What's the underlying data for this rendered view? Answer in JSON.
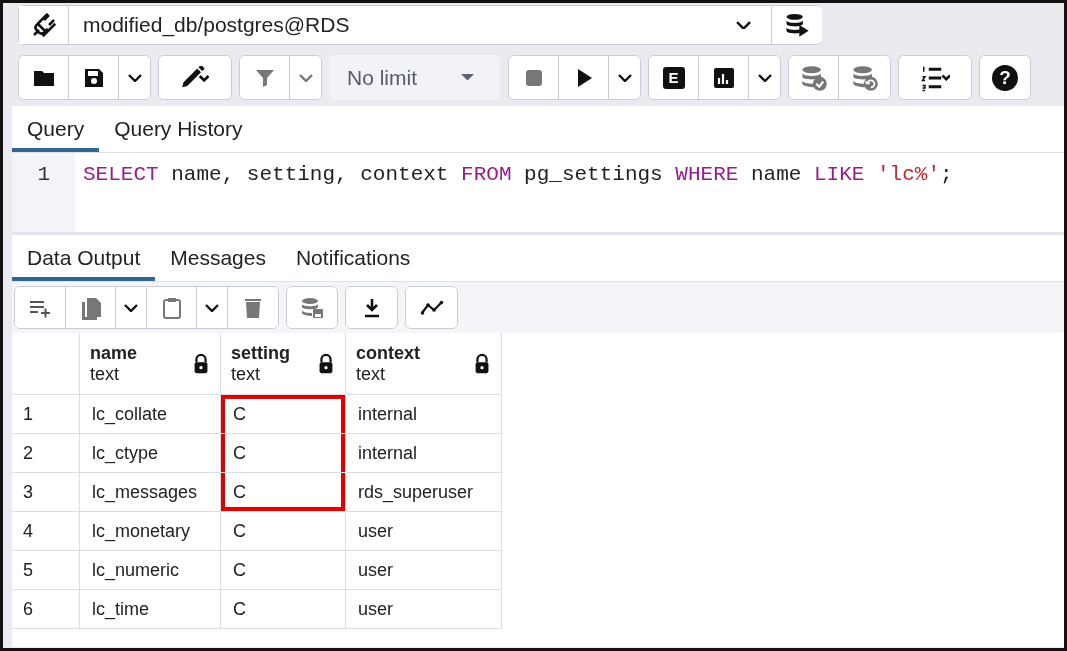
{
  "connection": {
    "title": "modified_db/postgres@RDS"
  },
  "toolbar": {
    "row_limit": "No limit",
    "explain_label": "E",
    "help_label": "?"
  },
  "query_tabs": [
    {
      "label": "Query",
      "selected": true
    },
    {
      "label": "Query History",
      "selected": false
    }
  ],
  "editor": {
    "lines": [
      {
        "number": "1",
        "tokens": [
          {
            "text": "SELECT",
            "kind": "keyword"
          },
          {
            "text": " name, setting, context ",
            "kind": "plain"
          },
          {
            "text": "FROM",
            "kind": "keyword"
          },
          {
            "text": " pg_settings ",
            "kind": "plain"
          },
          {
            "text": "WHERE",
            "kind": "keyword"
          },
          {
            "text": " name ",
            "kind": "plain"
          },
          {
            "text": "LIKE",
            "kind": "keyword"
          },
          {
            "text": " 'lc%'",
            "kind": "string"
          },
          {
            "text": ";",
            "kind": "plain"
          }
        ]
      }
    ]
  },
  "output_tabs": [
    {
      "label": "Data Output",
      "selected": true
    },
    {
      "label": "Messages",
      "selected": false
    },
    {
      "label": "Notifications",
      "selected": false
    }
  ],
  "table": {
    "columns": [
      {
        "name": "name",
        "type": "text"
      },
      {
        "name": "setting",
        "type": "text"
      },
      {
        "name": "context",
        "type": "text"
      }
    ],
    "rows": [
      {
        "number": "1",
        "cells": [
          {
            "text": "lc_collate",
            "highlighted": false
          },
          {
            "text": "C",
            "highlighted": true
          },
          {
            "text": "internal",
            "highlighted": false
          }
        ]
      },
      {
        "number": "2",
        "cells": [
          {
            "text": "lc_ctype",
            "highlighted": false
          },
          {
            "text": "C",
            "highlighted": true
          },
          {
            "text": "internal",
            "highlighted": false
          }
        ]
      },
      {
        "number": "3",
        "cells": [
          {
            "text": "lc_messages",
            "highlighted": false
          },
          {
            "text": "C",
            "highlighted": true
          },
          {
            "text": "rds_superuser",
            "highlighted": false
          }
        ]
      },
      {
        "number": "4",
        "cells": [
          {
            "text": "lc_monetary",
            "highlighted": false
          },
          {
            "text": "C",
            "highlighted": false
          },
          {
            "text": "user",
            "highlighted": false
          }
        ]
      },
      {
        "number": "5",
        "cells": [
          {
            "text": "lc_numeric",
            "highlighted": false
          },
          {
            "text": "C",
            "highlighted": false
          },
          {
            "text": "user",
            "highlighted": false
          }
        ]
      },
      {
        "number": "6",
        "cells": [
          {
            "text": "lc_time",
            "highlighted": false
          },
          {
            "text": "C",
            "highlighted": false
          },
          {
            "text": "user",
            "highlighted": false
          }
        ]
      }
    ]
  }
}
